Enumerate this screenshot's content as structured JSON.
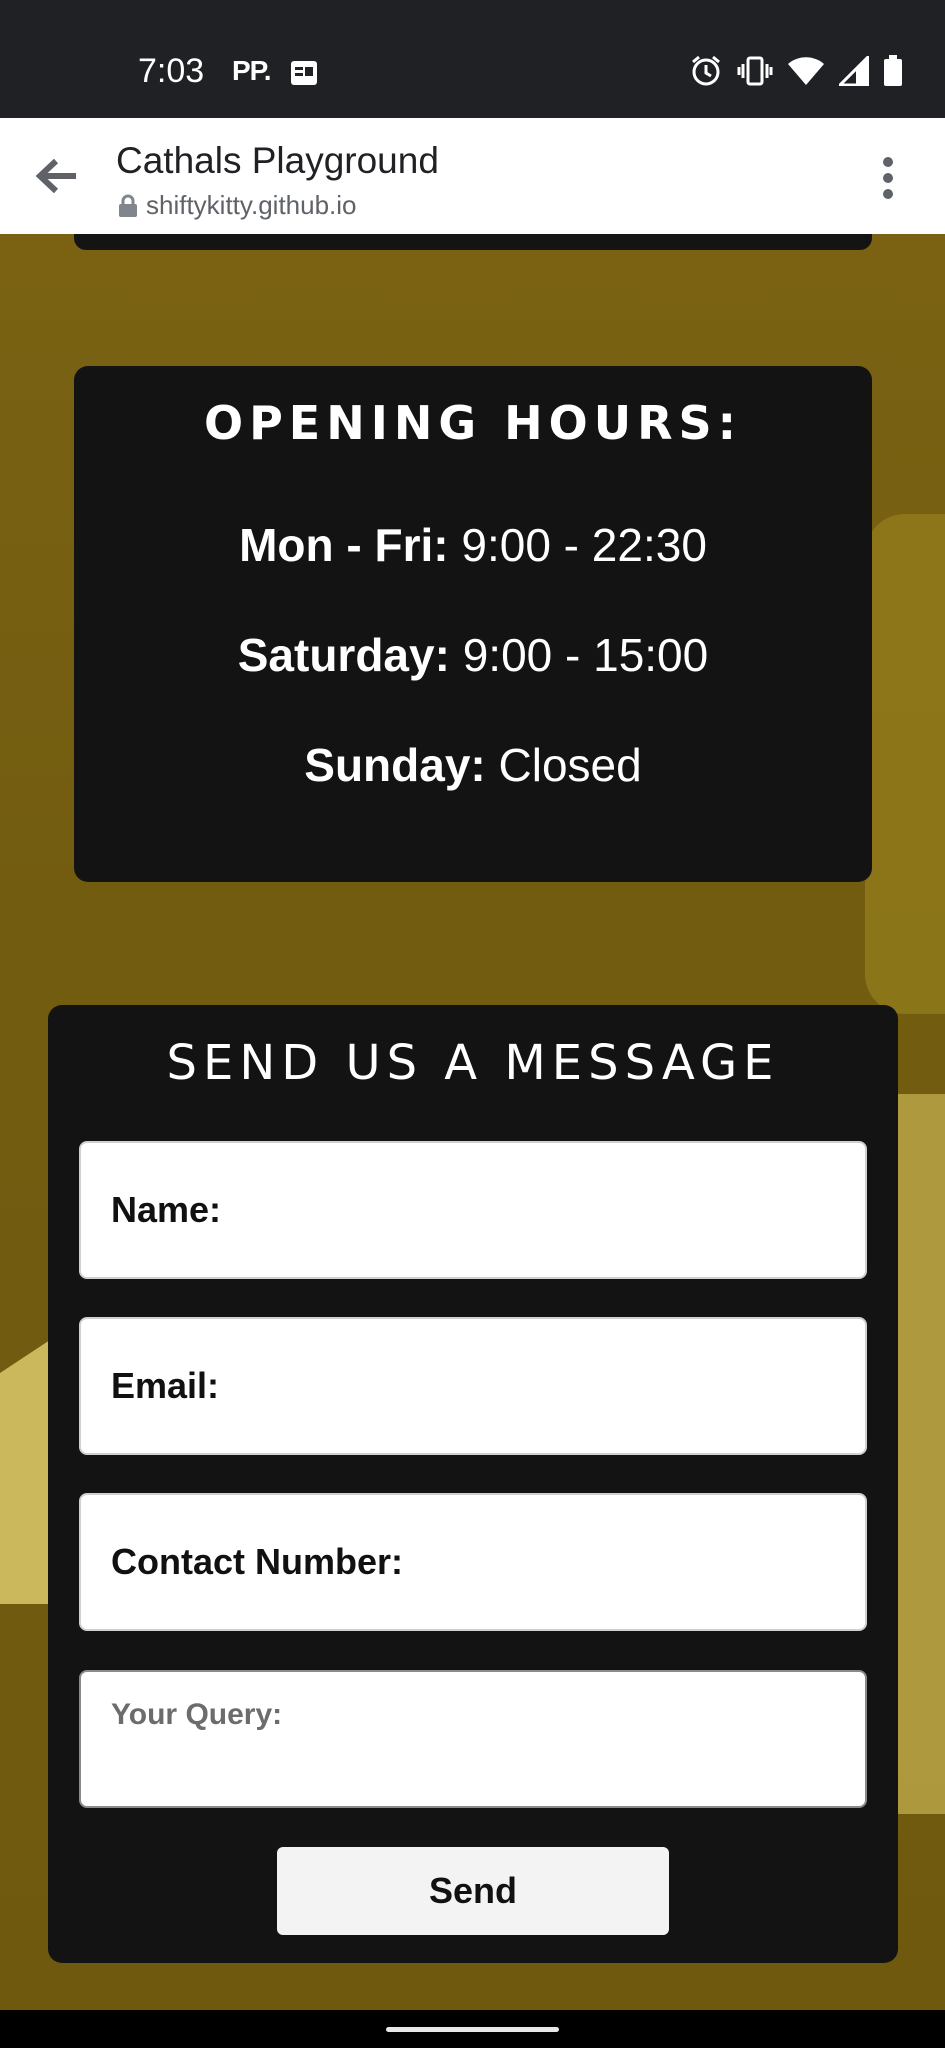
{
  "status_bar": {
    "time": "7:03",
    "carrier": "PP.",
    "icons": [
      "news-icon",
      "alarm-icon",
      "vibrate-icon",
      "wifi-icon",
      "signal-icon",
      "battery-icon"
    ]
  },
  "browser": {
    "title": "Cathals Playground",
    "url": "shiftykitty.github.io",
    "icons": [
      "back-arrow-icon",
      "lock-icon",
      "more-vert-icon"
    ]
  },
  "hours": {
    "title": "OPENING HOURS:",
    "lines": [
      {
        "day": "Mon - Fri:",
        "time": "9:00 - 22:30"
      },
      {
        "day": "Saturday:",
        "time": "9:00 - 15:00"
      },
      {
        "day": "Sunday:",
        "time": "Closed"
      }
    ]
  },
  "message": {
    "title": "SEND US A MESSAGE",
    "name_label": "Name:",
    "email_label": "Email:",
    "contact_label": "Contact Number:",
    "query_placeholder": "Your Query:",
    "send_label": "Send"
  },
  "colors": {
    "card": "#131313",
    "background": "#735d10",
    "status_bar": "#202124"
  }
}
